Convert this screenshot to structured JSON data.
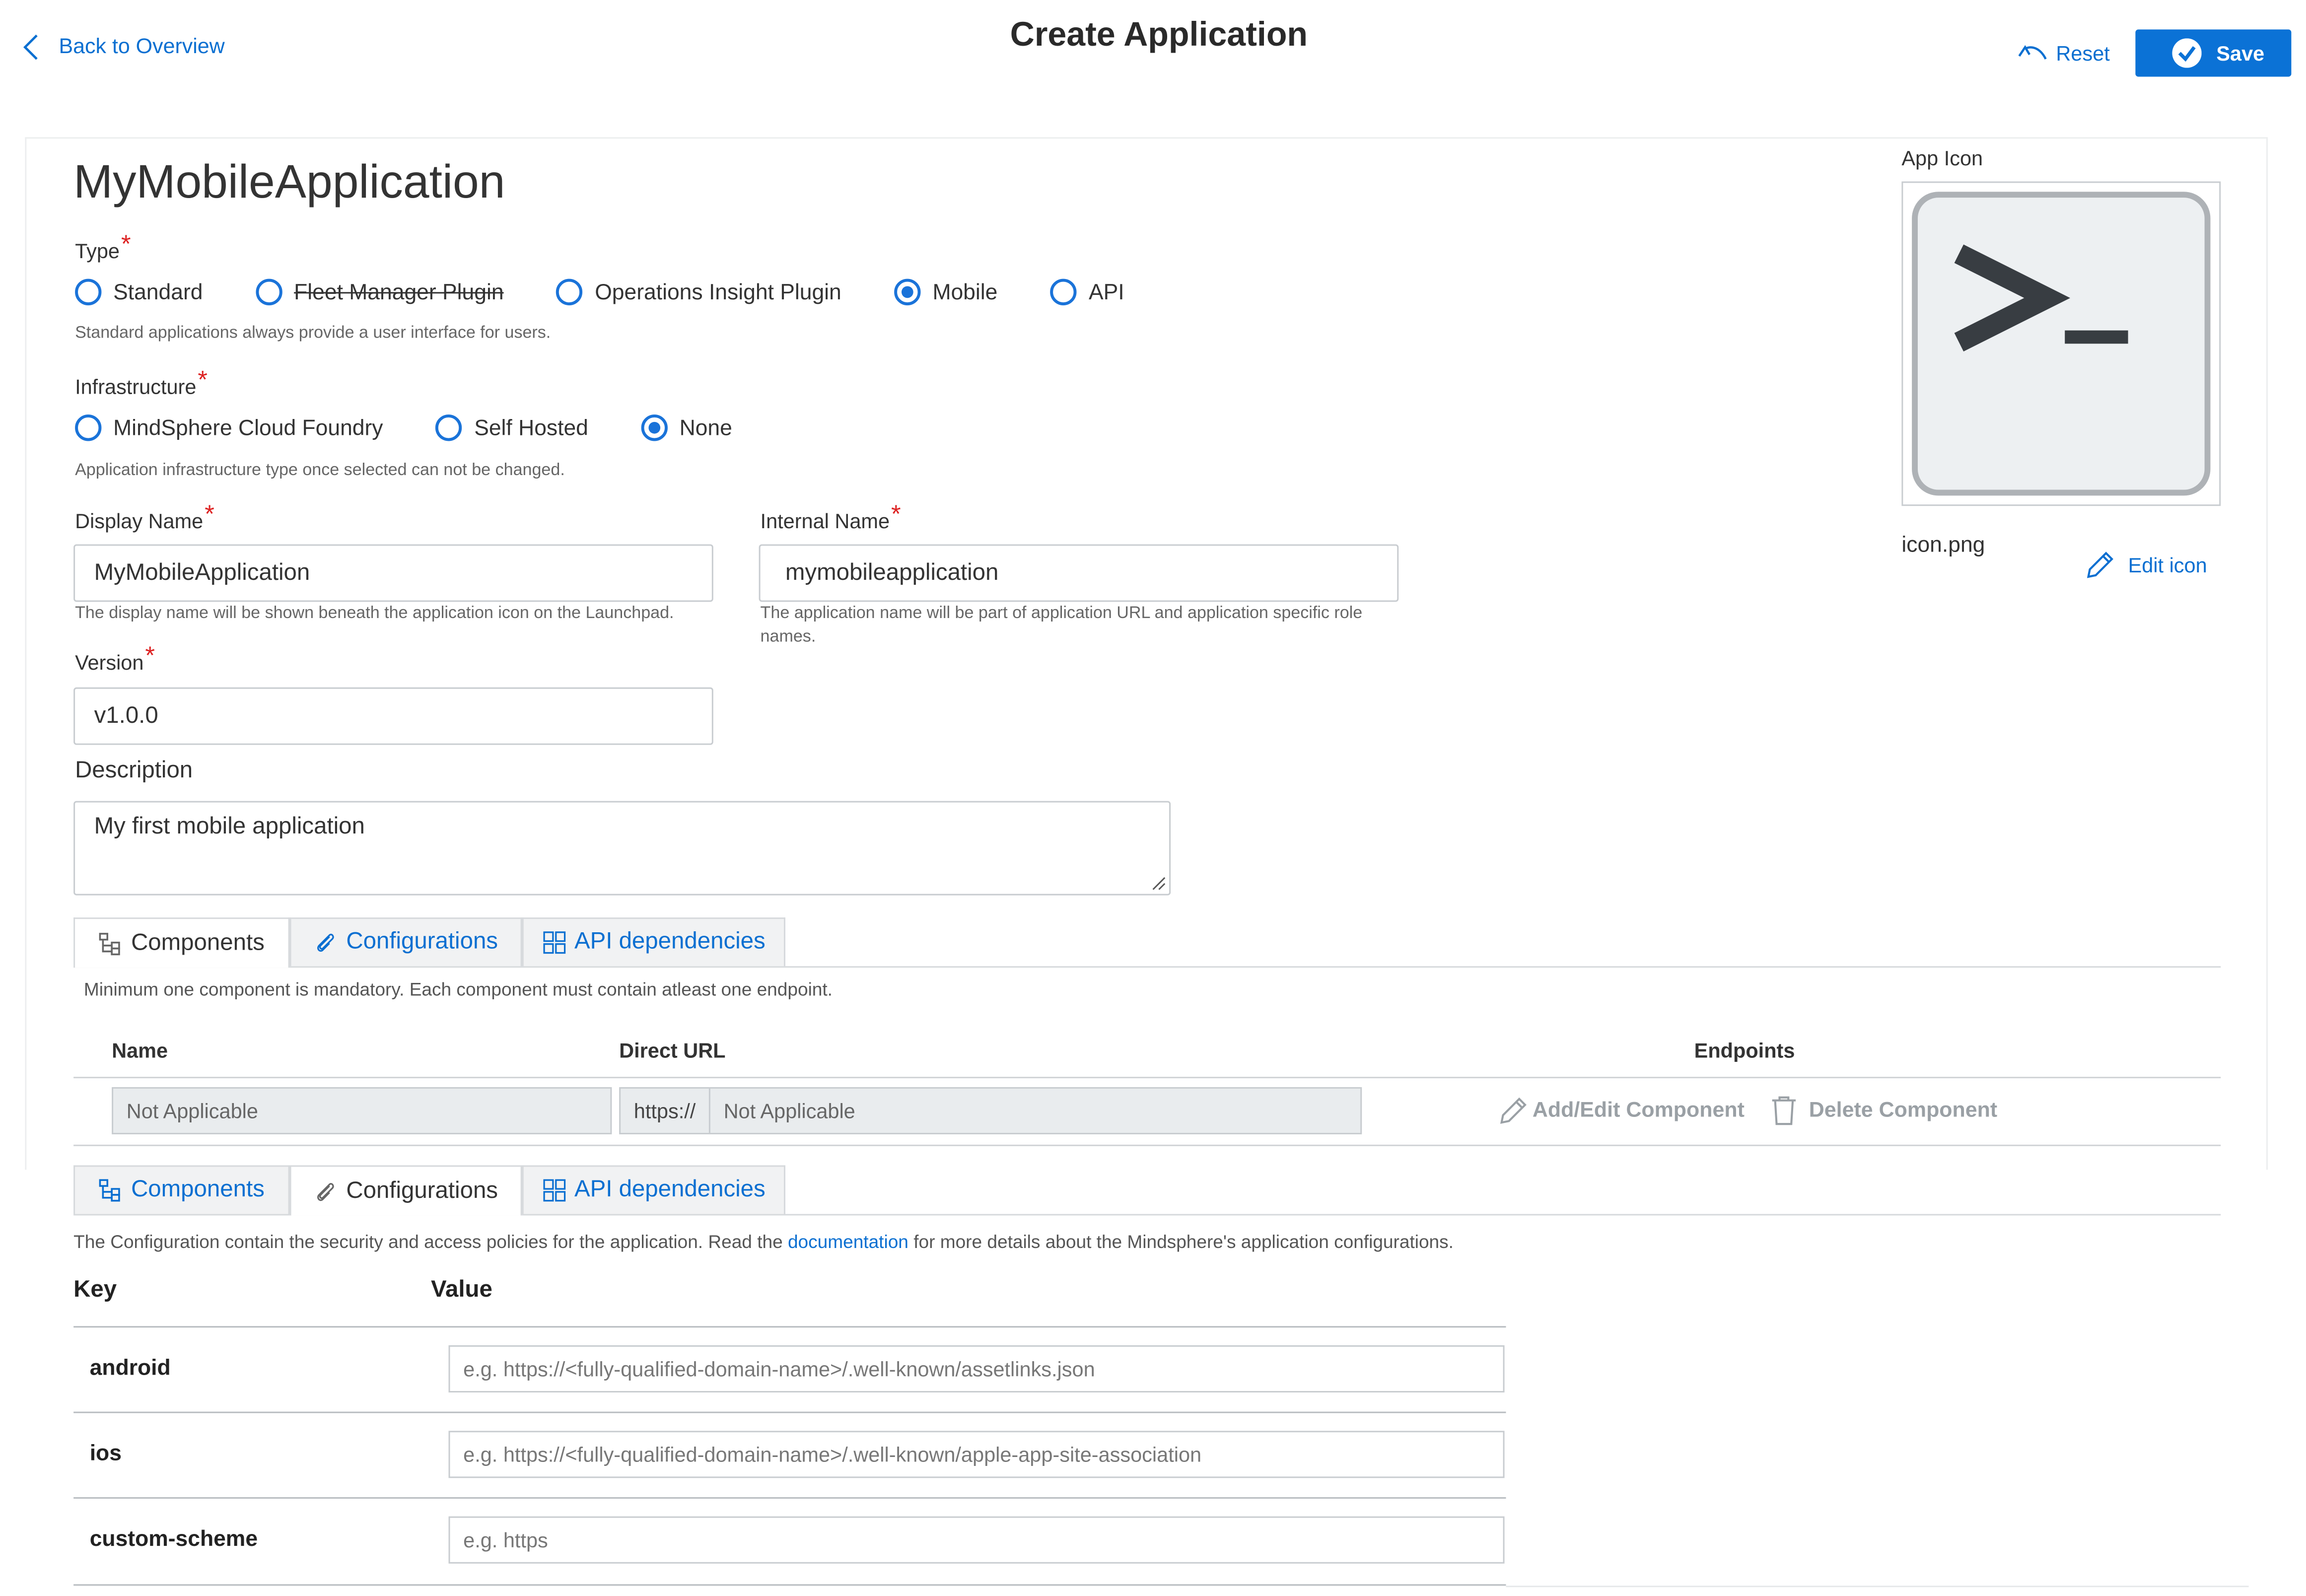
{
  "header": {
    "back_label": "Back to Overview",
    "title": "Create Application",
    "reset_label": "Reset",
    "save_label": "Save"
  },
  "app": {
    "heading": "MyMobileApplication",
    "type": {
      "label": "Type",
      "options": [
        "Standard",
        "Fleet Manager Plugin",
        "Operations Insight Plugin",
        "Mobile",
        "API"
      ],
      "selected": "Mobile",
      "help": "Standard applications always provide a user interface for users."
    },
    "infrastructure": {
      "label": "Infrastructure",
      "options": [
        "MindSphere Cloud Foundry",
        "Self Hosted",
        "None"
      ],
      "selected": "None",
      "help": "Application infrastructure type once selected can not be changed."
    },
    "display_name": {
      "label": "Display Name",
      "value": "MyMobileApplication",
      "help": "The display name will be shown beneath the application icon on the Launchpad."
    },
    "internal_name": {
      "label": "Internal Name",
      "value": "mymobileapplication",
      "help": "The application name will be part of application URL and application specific role names."
    },
    "version": {
      "label": "Version",
      "value": "v1.0.0"
    },
    "description": {
      "label": "Description",
      "value": "My first mobile application"
    }
  },
  "icon": {
    "label": "App Icon",
    "filename": "icon.png",
    "edit_label": "Edit icon",
    "glyph": ">_"
  },
  "tabs": [
    "Components",
    "Configurations",
    "API dependencies"
  ],
  "components": {
    "note": "Minimum one component is mandatory. Each component must contain atleast one endpoint.",
    "columns": [
      "Name",
      "Direct URL",
      "Endpoints"
    ],
    "row": {
      "name_placeholder": "Not Applicable",
      "url_prefix": "https://",
      "url_placeholder": "Not Applicable",
      "add_edit_label": "Add/Edit Component",
      "delete_label": "Delete Component"
    }
  },
  "configurations": {
    "note_before": "The Configuration contain the security and access policies for the application. Read the ",
    "link": "documentation",
    "note_after": " for more details about the Mindsphere's application configurations.",
    "columns": [
      "Key",
      "Value"
    ],
    "rows": [
      {
        "key": "android",
        "placeholder": "e.g. https://<fully-qualified-domain-name>/.well-known/assetlinks.json"
      },
      {
        "key": "ios",
        "placeholder": "e.g. https://<fully-qualified-domain-name>/.well-known/apple-app-site-association"
      },
      {
        "key": "custom-scheme",
        "placeholder": "e.g. https"
      }
    ]
  },
  "colors": {
    "accent": "#0a6fd1",
    "save": "#0b72d6",
    "required": "#dd2222"
  }
}
